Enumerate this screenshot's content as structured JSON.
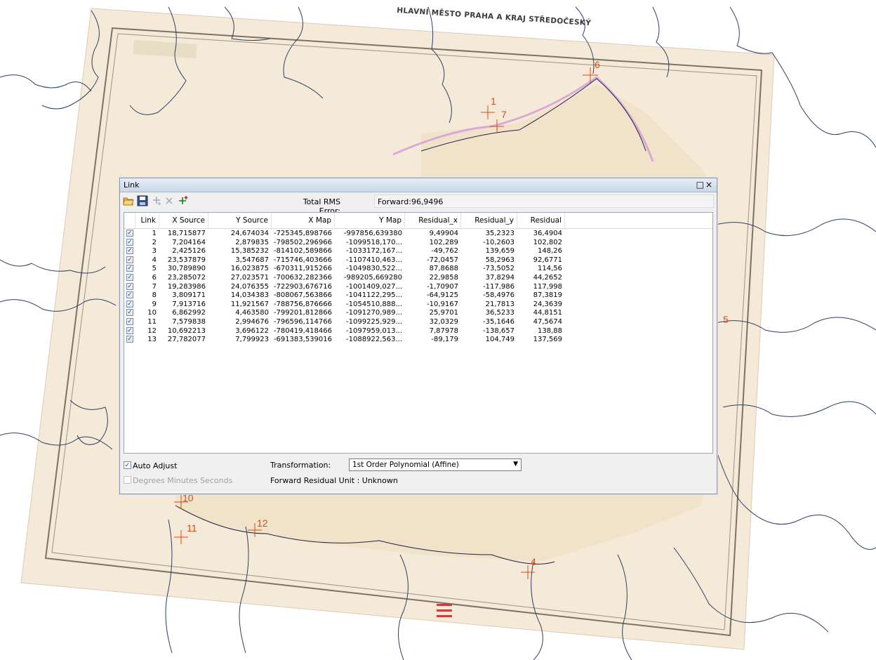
{
  "map": {
    "title": "HLAVNÍ MĚSTO PRAHA A KRAJ STŘEDOČESKÝ",
    "link_markers": [
      "1",
      "7",
      "6",
      "5",
      "10",
      "11",
      "12",
      "4"
    ]
  },
  "window": {
    "title": "Link",
    "controls": {
      "restore": "□",
      "close": "×"
    }
  },
  "toolbar": {
    "icons": [
      "open-folder-icon",
      "save-icon",
      "add-link-icon",
      "delete-link-icon",
      "auto-add-link-icon"
    ],
    "rms_label": "Total RMS Error:",
    "rms_value": "Forward:96,9496"
  },
  "table": {
    "columns": [
      "Link",
      "X Source",
      "Y Source",
      "X Map",
      "Y Map",
      "Residual_x",
      "Residual_y",
      "Residual"
    ],
    "rows": [
      {
        "checked": true,
        "cells": [
          "1",
          "18,715877",
          "24,674034",
          "-725345,898766",
          "-997856,639380",
          "9,49904",
          "35,2323",
          "36,4904"
        ]
      },
      {
        "checked": true,
        "cells": [
          "2",
          "7,204164",
          "2,879835",
          "-798502,296966",
          "-1099518,170...",
          "102,289",
          "-10,2603",
          "102,802"
        ]
      },
      {
        "checked": true,
        "cells": [
          "3",
          "2,425126",
          "15,385232",
          "-814102,589866",
          "-1033172,167...",
          "-49,762",
          "139,659",
          "148,26"
        ]
      },
      {
        "checked": true,
        "cells": [
          "4",
          "23,537879",
          "3,547687",
          "-715746,403666",
          "-1107410,463...",
          "-72,0457",
          "58,2963",
          "92,6771"
        ]
      },
      {
        "checked": true,
        "cells": [
          "5",
          "30,789890",
          "16,023875",
          "-670311,915266",
          "-1049830,522...",
          "87,8688",
          "-73,5052",
          "114,56"
        ]
      },
      {
        "checked": true,
        "cells": [
          "6",
          "23,285072",
          "27,023571",
          "-700632,282366",
          "-989205,669280",
          "22,9858",
          "37,8294",
          "44,2652"
        ]
      },
      {
        "checked": true,
        "cells": [
          "7",
          "19,283986",
          "24,076355",
          "-722903,676716",
          "-1001409,027...",
          "-1,70907",
          "-117,986",
          "117,998"
        ]
      },
      {
        "checked": true,
        "cells": [
          "8",
          "3,809171",
          "14,034383",
          "-808067,563866",
          "-1041122,295...",
          "-64,9125",
          "-58,4976",
          "87,3819"
        ]
      },
      {
        "checked": true,
        "cells": [
          "9",
          "7,913716",
          "11,921567",
          "-788756,876666",
          "-1054510,888...",
          "-10,9167",
          "21,7813",
          "24,3639"
        ]
      },
      {
        "checked": true,
        "cells": [
          "10",
          "6,862992",
          "4,463580",
          "-799201,812866",
          "-1091270,989...",
          "25,9701",
          "36,5233",
          "44,8151"
        ]
      },
      {
        "checked": true,
        "cells": [
          "11",
          "7,579838",
          "2,994676",
          "-796596,114766",
          "-1099225,929...",
          "32,0329",
          "-35,1646",
          "47,5674"
        ]
      },
      {
        "checked": true,
        "cells": [
          "12",
          "10,692213",
          "3,696122",
          "-780419,418466",
          "-1097959,013...",
          "7,87978",
          "-138,657",
          "138,88"
        ]
      },
      {
        "checked": true,
        "cells": [
          "13",
          "27,782077",
          "7,799923",
          "-691383,539016",
          "-1088922,563...",
          "-89,179",
          "104,749",
          "137,569"
        ]
      }
    ]
  },
  "bottom": {
    "auto_adjust_label": "Auto Adjust",
    "auto_adjust_checked": true,
    "dms_label": "Degrees Minutes Seconds",
    "dms_checked": false,
    "transformation_label": "Transformation:",
    "transformation_value": "1st Order Polynomial (Affine)",
    "forward_residual_unit": "Forward Residual Unit : Unknown"
  }
}
